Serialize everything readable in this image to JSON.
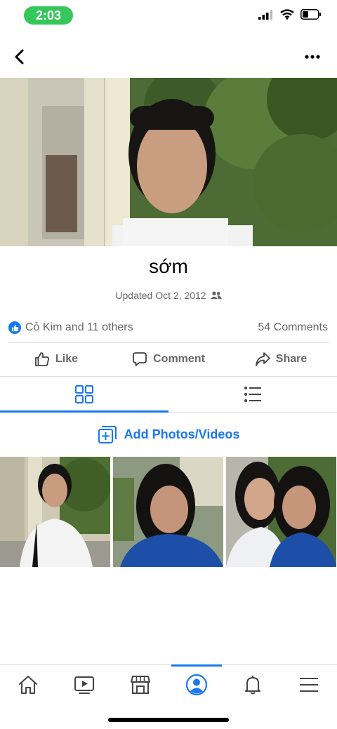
{
  "status_bar": {
    "time": "2:03"
  },
  "album": {
    "title": "sớm",
    "updated": "Updated Oct 2, 2012",
    "reactions_text": "Cỏ Kim and 11 others",
    "comments_text": "54 Comments"
  },
  "actions": {
    "like": "Like",
    "comment": "Comment",
    "share": "Share"
  },
  "add_photos_label": "Add Photos/Videos",
  "colors": {
    "accent": "#1877f2",
    "status_green": "#34c759",
    "muted_text": "#65676b"
  },
  "icons": {
    "back": "chevron-left-icon",
    "more": "more-icon",
    "audience": "friends-icon",
    "grid": "grid-icon",
    "list": "list-icon",
    "tabs": [
      "home-icon",
      "video-icon",
      "marketplace-icon",
      "profile-icon",
      "bell-icon",
      "menu-icon"
    ]
  }
}
